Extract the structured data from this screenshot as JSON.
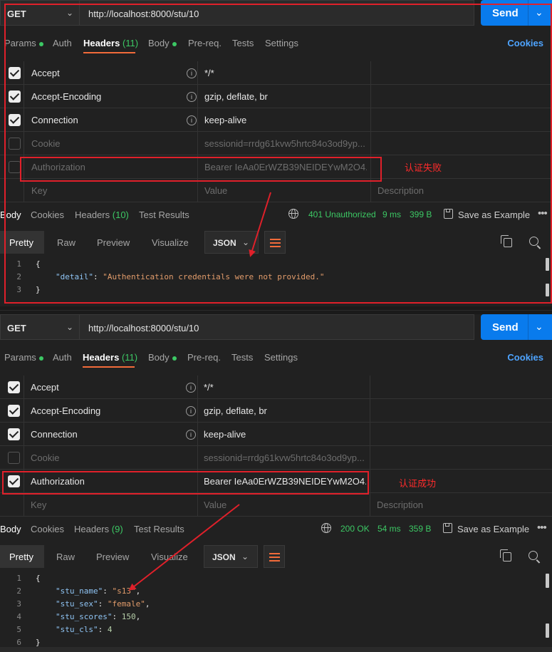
{
  "request1": {
    "method": "GET",
    "url": "http://localhost:8000/stu/10",
    "send_label": "Send",
    "tabs": [
      {
        "label": "Params",
        "dot": true
      },
      {
        "label": "Auth"
      },
      {
        "label": "Headers",
        "count": "(11)",
        "active": true
      },
      {
        "label": "Body",
        "dot": true
      },
      {
        "label": "Pre-req."
      },
      {
        "label": "Tests"
      },
      {
        "label": "Settings"
      }
    ],
    "cookies_label": "Cookies",
    "headers": [
      {
        "key": "Accept",
        "value": "*/*",
        "checked": true
      },
      {
        "key": "Accept-Encoding",
        "value": "gzip, deflate, br",
        "checked": true
      },
      {
        "key": "Connection",
        "value": "keep-alive",
        "checked": true
      },
      {
        "key": "Cookie",
        "value": "sessionid=rrdg61kvw5hrtc84o3od9yp...",
        "checked": false
      },
      {
        "key": "Authorization",
        "value": "Bearer IeAa0ErWZB39NEIDEYwM2O4...",
        "checked": false
      }
    ],
    "placeholder": {
      "key": "Key",
      "value": "Value",
      "desc": "Description"
    },
    "note": "认证失败",
    "response": {
      "tabs": [
        {
          "label": "Body",
          "active": true
        },
        {
          "label": "Cookies"
        },
        {
          "label": "Headers",
          "count": "(10)"
        },
        {
          "label": "Test Results"
        }
      ],
      "status": "401 Unauthorized",
      "time": "9 ms",
      "size": "399 B",
      "save_label": "Save as Example",
      "more": "•••",
      "view_modes": [
        "Pretty",
        "Raw",
        "Preview",
        "Visualize"
      ],
      "format": "JSON",
      "code": [
        {
          "n": "1",
          "text": "{"
        },
        {
          "n": "2",
          "key": "\"detail\"",
          "value": "\"Authentication credentials were not provided.\""
        },
        {
          "n": "3",
          "text": "}"
        }
      ]
    }
  },
  "request2": {
    "method": "GET",
    "url": "http://localhost:8000/stu/10",
    "send_label": "Send",
    "tabs": [
      {
        "label": "Params",
        "dot": true
      },
      {
        "label": "Auth"
      },
      {
        "label": "Headers",
        "count": "(11)",
        "active": true
      },
      {
        "label": "Body",
        "dot": true
      },
      {
        "label": "Pre-req."
      },
      {
        "label": "Tests"
      },
      {
        "label": "Settings"
      }
    ],
    "cookies_label": "Cookies",
    "headers": [
      {
        "key": "Accept",
        "value": "*/*",
        "checked": true
      },
      {
        "key": "Accept-Encoding",
        "value": "gzip, deflate, br",
        "checked": true
      },
      {
        "key": "Connection",
        "value": "keep-alive",
        "checked": true
      },
      {
        "key": "Cookie",
        "value": "sessionid=rrdg61kvw5hrtc84o3od9yp...",
        "checked": false
      },
      {
        "key": "Authorization",
        "value": "Bearer IeAa0ErWZB39NEIDEYwM2O4...",
        "checked": true
      }
    ],
    "placeholder": {
      "key": "Key",
      "value": "Value",
      "desc": "Description"
    },
    "note": "认证成功",
    "response": {
      "tabs": [
        {
          "label": "Body",
          "active": true
        },
        {
          "label": "Cookies"
        },
        {
          "label": "Headers",
          "count": "(9)"
        },
        {
          "label": "Test Results"
        }
      ],
      "status": "200 OK",
      "time": "54 ms",
      "size": "359 B",
      "save_label": "Save as Example",
      "more": "•••",
      "view_modes": [
        "Pretty",
        "Raw",
        "Preview",
        "Visualize"
      ],
      "format": "JSON",
      "code": [
        {
          "n": "1",
          "text": "{"
        },
        {
          "n": "2",
          "key": "\"stu_name\"",
          "value": "\"s13\"",
          "type": "string",
          "comma": true
        },
        {
          "n": "3",
          "key": "\"stu_sex\"",
          "value": "\"female\"",
          "type": "string",
          "comma": true
        },
        {
          "n": "4",
          "key": "\"stu_scores\"",
          "value": "150",
          "type": "number",
          "comma": true
        },
        {
          "n": "5",
          "key": "\"stu_cls\"",
          "value": "4",
          "type": "number"
        },
        {
          "n": "6",
          "text": "}"
        }
      ]
    }
  },
  "colors": {
    "accent": "#097bed",
    "success": "#3cc864",
    "annotation": "#e0202a",
    "active_tab_underline": "#f26b3a"
  },
  "icons": [
    "chevron-down-icon",
    "info-icon",
    "checkbox-icon",
    "globe-icon",
    "save-icon",
    "more-icon",
    "wrap-lines-icon",
    "copy-icon",
    "search-icon"
  ]
}
